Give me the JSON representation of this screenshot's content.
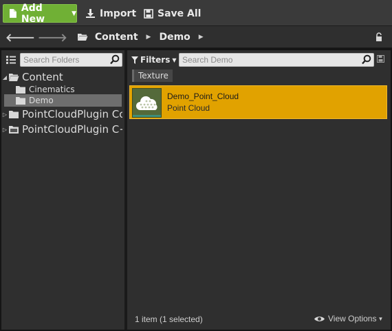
{
  "toolbar": {
    "add_new_label": "Add New",
    "import_label": "Import",
    "save_all_label": "Save All"
  },
  "path": {
    "crumbs": [
      "Content",
      "Demo"
    ]
  },
  "folders": {
    "search_placeholder": "Search Folders",
    "tree": [
      {
        "label": "Content",
        "level": 0,
        "expanded": true
      },
      {
        "label": "Cinematics",
        "level": 1
      },
      {
        "label": "Demo",
        "level": 1,
        "selected": true
      },
      {
        "label": "PointCloudPlugin Co",
        "level": 0
      },
      {
        "label": "PointCloudPlugin C+",
        "level": 0
      }
    ]
  },
  "assets": {
    "filters_label": "Filters",
    "search_placeholder": "Search Demo",
    "active_filter": "Texture",
    "items": [
      {
        "name": "Demo_Point_Cloud",
        "type": "Point Cloud",
        "selected": true
      }
    ],
    "status": "1 item (1 selected)",
    "view_options_label": "View Options"
  },
  "colors": {
    "accent_green": "#70b035",
    "selection_orange": "#e1a200"
  }
}
